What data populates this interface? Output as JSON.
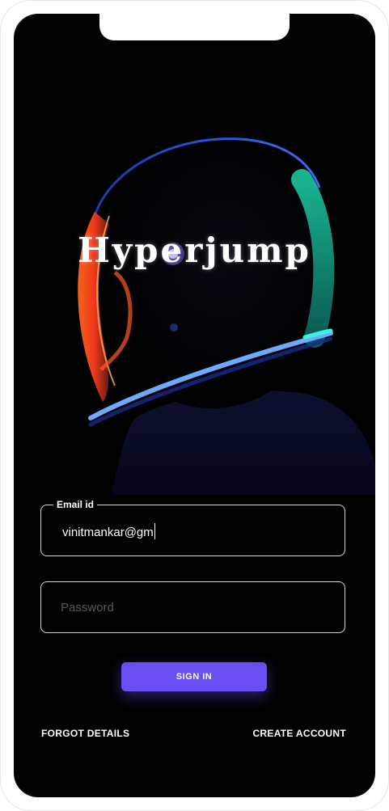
{
  "app": {
    "brand": "Hyperjump"
  },
  "login_form": {
    "email": {
      "label": "Email id",
      "value": "vinitmankar@gm"
    },
    "password": {
      "placeholder": "Password",
      "value": ""
    },
    "sign_in_label": "SIGN IN",
    "forgot_label": "FORGOT DETAILS",
    "create_label": "CREATE ACCOUNT"
  },
  "theme": {
    "background": "#000000",
    "accent": "#6a4ef3",
    "field_border": "#d9d9d9",
    "placeholder": "#5a5a5a"
  },
  "hero_image": {
    "subject": "astronaut-helmet-neon-photo"
  }
}
